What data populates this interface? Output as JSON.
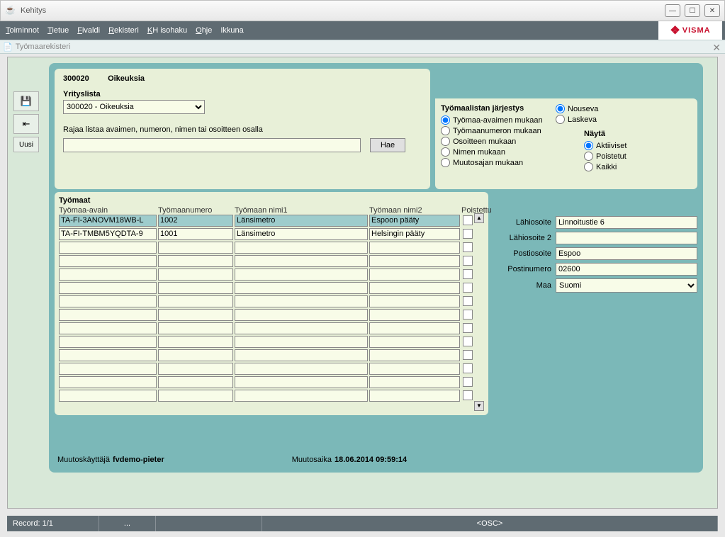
{
  "window": {
    "title": "Kehitys"
  },
  "menu": [
    "Toiminnot",
    "Tietue",
    "Fivaldi",
    "Rekisteri",
    "KH isohaku",
    "Ohje",
    "Ikkuna"
  ],
  "logo": "VISMA",
  "mdi": {
    "title": "Työmaarekisteri"
  },
  "left_tools": {
    "uusi": "Uusi"
  },
  "header": {
    "code": "300020",
    "name": "Oikeuksia"
  },
  "yrityslista": {
    "label": "Yrityslista",
    "value": "300020 - Oikeuksia"
  },
  "filter": {
    "label": "Rajaa listaa avaimen, numeron, nimen tai osoitteen osalla",
    "value": "",
    "hae": "Hae"
  },
  "sort": {
    "title": "Työmaalistan järjestys",
    "options": [
      "Työmaa-avaimen mukaan",
      "Työmaanumeron mukaan",
      "Osoitteen mukaan",
      "Nimen mukaan",
      "Muutosajan mukaan"
    ],
    "direction": {
      "asc": "Nouseva",
      "desc": "Laskeva"
    },
    "show": {
      "title": "Näytä",
      "options": [
        "Aktiiviset",
        "Poistetut",
        "Kaikki"
      ]
    }
  },
  "grid": {
    "title": "Työmaat",
    "headers": {
      "avain": "Työmaa-avain",
      "numero": "Työmaanumero",
      "nimi1": "Työmaan nimi1",
      "nimi2": "Työmaan nimi2",
      "poistettu": "Poistettu"
    },
    "rows": [
      {
        "avain": "TA-FI-3ANOVM18WB-L",
        "numero": "1002",
        "nimi1": "Länsimetro",
        "nimi2": "Espoon pääty",
        "selected": true
      },
      {
        "avain": "TA-FI-TMBM5YQDTA-9",
        "numero": "1001",
        "nimi1": "Länsimetro",
        "nimi2": "Helsingin pääty",
        "selected": false
      }
    ],
    "empty_rows": 12
  },
  "detail": {
    "lahiosoite": {
      "label": "Lähiosoite",
      "value": "Linnoitustie 6"
    },
    "lahiosoite2": {
      "label": "Lähiosoite 2",
      "value": ""
    },
    "postiosoite": {
      "label": "Postiosoite",
      "value": "Espoo"
    },
    "postinumero": {
      "label": "Postinumero",
      "value": "02600"
    },
    "maa": {
      "label": "Maa",
      "value": "Suomi"
    }
  },
  "footer": {
    "user_label": "Muutoskäyttäjä",
    "user": "fvdemo-pieter",
    "time_label": "Muutosaika",
    "time": "18.06.2014 09:59:14"
  },
  "status": {
    "record": "Record: 1/1",
    "dots": "...",
    "osc": "<OSC>"
  }
}
